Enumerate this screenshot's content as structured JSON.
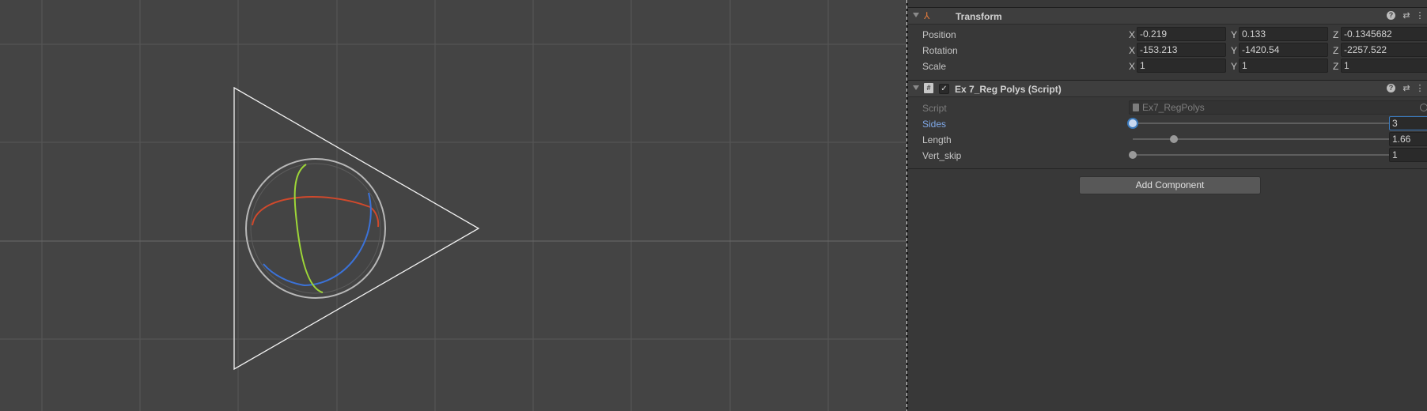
{
  "transform": {
    "title": "Transform",
    "icon": "transform-axes-icon",
    "rows": [
      {
        "label": "Position",
        "x": "-0.219",
        "y": "0.133",
        "z": "-0.1345682"
      },
      {
        "label": "Rotation",
        "x": "-153.213",
        "y": "-1420.54",
        "z": "-2257.522"
      },
      {
        "label": "Scale",
        "x": "1",
        "y": "1",
        "z": "1"
      }
    ],
    "axes": {
      "x": "X",
      "y": "Y",
      "z": "Z"
    }
  },
  "script_component": {
    "title": "Ex 7_Reg Polys (Script)",
    "enabled": true,
    "check": "✓",
    "script_label": "Script",
    "script_value": "Ex7_RegPolys",
    "sliders": [
      {
        "label": "Sides",
        "value": "3",
        "level": 0.0
      },
      {
        "label": "Length",
        "value": "1.66",
        "level": 0.16
      },
      {
        "label": "Vert_skip",
        "value": "1",
        "level": 0.0
      }
    ]
  },
  "add_component_label": "Add Component",
  "colors": {
    "scene_bg": "#444444",
    "grid": "#5a5a5a",
    "accent": "#3a79bb",
    "gizmo_x": "#d0492c",
    "gizmo_y": "#9dd638",
    "gizmo_z": "#3b72d8"
  }
}
